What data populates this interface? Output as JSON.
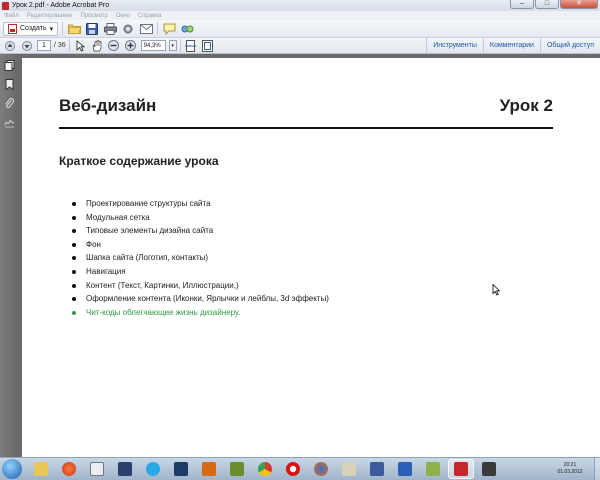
{
  "window": {
    "title": "Урок 2.pdf - Adobe Acrobat Pro",
    "buttons": {
      "minimize": "–",
      "maximize": "□",
      "close": "✕"
    }
  },
  "menu": [
    "Файл",
    "Редактирование",
    "Просмотр",
    "Окно",
    "Справка"
  ],
  "toolbar": {
    "create_label": "Создать",
    "create_arrow": "▾"
  },
  "nav": {
    "page_current": "1",
    "page_total": "/ 36",
    "zoom": "94,3%",
    "zoom_arrow": "▾"
  },
  "right_links": [
    "Инструменты",
    "Комментарии",
    "Общий доступ"
  ],
  "document": {
    "title": "Веб-дизайн",
    "lesson": "Урок 2",
    "subtitle": "Краткое содержание урока",
    "items": [
      "Проектирование структуры сайта",
      "Модульная сетка",
      "Типовые элементы дизайна сайта",
      "Фон",
      "Шапка сайта (Логотип, контакты)",
      "Навигация",
      "Контент  (Текст, Картинки, Иллюстрации,)",
      "Оформление контента (Иконки, Ярлычки и лейблы, 3d эффекты)",
      "Чит-коды облегчающие жизнь дизайнеру."
    ],
    "highlight_color": "#2f9a4a"
  },
  "taskbar": {
    "clock_time": "20:21",
    "clock_date": "01.03.2012"
  }
}
